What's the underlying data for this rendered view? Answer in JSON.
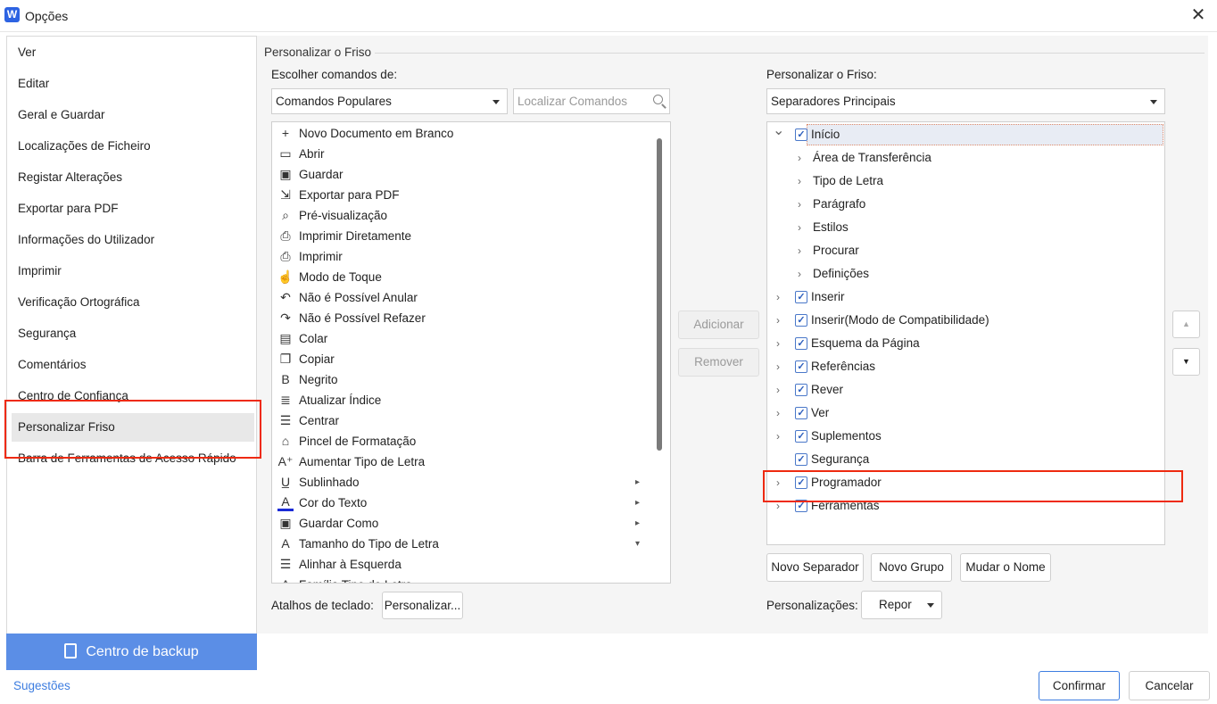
{
  "window": {
    "title": "Opções",
    "logo": "W",
    "close_label": "✕"
  },
  "nav": {
    "items": [
      "Ver",
      "Editar",
      "Geral e Guardar",
      "Localizações de Ficheiro",
      "Registar Alterações",
      "Exportar para PDF",
      "Informações do Utilizador",
      "Imprimir",
      "Verificação Ortográfica",
      "Segurança",
      "Comentários",
      "Centro de Confiança",
      "Personalizar Friso",
      "Barra de Ferramentas de Acesso Rápido"
    ],
    "active_index": 12
  },
  "backup": {
    "label": "Centro de backup"
  },
  "suggestions": {
    "label": "Sugestões"
  },
  "group": {
    "title": "Personalizar o Friso"
  },
  "left": {
    "choose_label": "Escolher comandos de:",
    "choose_value": "Comandos Populares",
    "search_placeholder": "Localizar Comandos",
    "commands": [
      {
        "icon": "new-document-icon",
        "glyph": "+",
        "label": "Novo Documento em Branco"
      },
      {
        "icon": "open-folder-icon",
        "glyph": "▭",
        "label": "Abrir"
      },
      {
        "icon": "save-icon",
        "glyph": "▣",
        "label": "Guardar"
      },
      {
        "icon": "export-pdf-icon",
        "glyph": "⇲",
        "label": "Exportar para PDF"
      },
      {
        "icon": "print-preview-icon",
        "glyph": "⌕",
        "label": "Pré-visualização"
      },
      {
        "icon": "print-direct-icon",
        "glyph": "⎙",
        "label": "Imprimir  Diretamente"
      },
      {
        "icon": "printer-icon",
        "glyph": "⎙",
        "label": "Imprimir"
      },
      {
        "icon": "touch-mode-icon",
        "glyph": "☝",
        "label": "Modo de Toque"
      },
      {
        "icon": "undo-icon",
        "glyph": "↶",
        "label": "Não é Possível Anular"
      },
      {
        "icon": "redo-icon",
        "glyph": "↷",
        "label": "Não é Possível Refazer"
      },
      {
        "icon": "paste-icon",
        "glyph": "▤",
        "label": "Colar"
      },
      {
        "icon": "copy-icon",
        "glyph": "❐",
        "label": "Copiar"
      },
      {
        "icon": "bold-icon",
        "glyph": "B",
        "label": "Negrito"
      },
      {
        "icon": "update-index-icon",
        "glyph": "≣",
        "label": "Atualizar  Índice"
      },
      {
        "icon": "align-center-icon",
        "glyph": "☰",
        "label": "Centrar"
      },
      {
        "icon": "format-painter-icon",
        "glyph": "⌂",
        "label": "Pincel de Formatação"
      },
      {
        "icon": "increase-font-icon",
        "glyph": "A⁺",
        "label": "Aumentar Tipo de Letra"
      },
      {
        "icon": "underline-icon",
        "glyph": "U̲",
        "label": "Sublinhado",
        "sub": "▸"
      },
      {
        "icon": "font-color-icon",
        "glyph": "A",
        "label": "Cor do Texto",
        "sub": "▸"
      },
      {
        "icon": "save-as-icon",
        "glyph": "▣",
        "label": "Guardar Como",
        "sub": "▸"
      },
      {
        "icon": "font-size-icon",
        "glyph": "A",
        "label": "Tamanho do Tipo de Letra",
        "sub": "▾"
      },
      {
        "icon": "align-left-icon",
        "glyph": "☰",
        "label": "Alinhar à Esquerda"
      },
      {
        "icon": "font-family-icon",
        "glyph": "A",
        "label": "Família Tipo de Letra"
      }
    ],
    "shortcuts_label": "Atalhos de teclado:",
    "customize_button": "Personalizar..."
  },
  "middle": {
    "add_button": "Adicionar",
    "remove_button": "Remover"
  },
  "right": {
    "customize_label": "Personalizar o Friso:",
    "tabs_value": "Separadores Principais",
    "tree": [
      {
        "label": "Início",
        "level": 0,
        "expanded": true,
        "checked": true,
        "selected": true
      },
      {
        "label": "Área de Transferência",
        "level": 1
      },
      {
        "label": "Tipo de Letra",
        "level": 1
      },
      {
        "label": "Parágrafo",
        "level": 1
      },
      {
        "label": "Estilos",
        "level": 1
      },
      {
        "label": "Procurar",
        "level": 1
      },
      {
        "label": "Definições",
        "level": 1
      },
      {
        "label": "Inserir",
        "level": 0,
        "checked": true
      },
      {
        "label": "Inserir(Modo de Compatibilidade)",
        "level": 0,
        "checked": true
      },
      {
        "label": "Esquema da Página",
        "level": 0,
        "checked": true
      },
      {
        "label": "Referências",
        "level": 0,
        "checked": true
      },
      {
        "label": "Rever",
        "level": 0,
        "checked": true
      },
      {
        "label": "Ver",
        "level": 0,
        "checked": true
      },
      {
        "label": "Suplementos",
        "level": 0,
        "checked": true
      },
      {
        "label": "Segurança",
        "level": 0,
        "checked": true,
        "no_chevron": true
      },
      {
        "label": "Programador",
        "level": 0,
        "checked": true
      },
      {
        "label": "Ferramentas",
        "level": 0,
        "checked": true
      }
    ],
    "new_tab_button": "Novo Separador",
    "new_group_button": "Novo Grupo",
    "rename_button": "Mudar o Nome",
    "customizations_label": "Personalizações:",
    "reset_button": "Repor"
  },
  "footer": {
    "confirm_button": "Confirmar",
    "cancel_button": "Cancelar"
  },
  "colors": {
    "accent": "#3d7de0",
    "highlight_red": "#ee2a10",
    "backup_bg": "#5b8ee6"
  }
}
